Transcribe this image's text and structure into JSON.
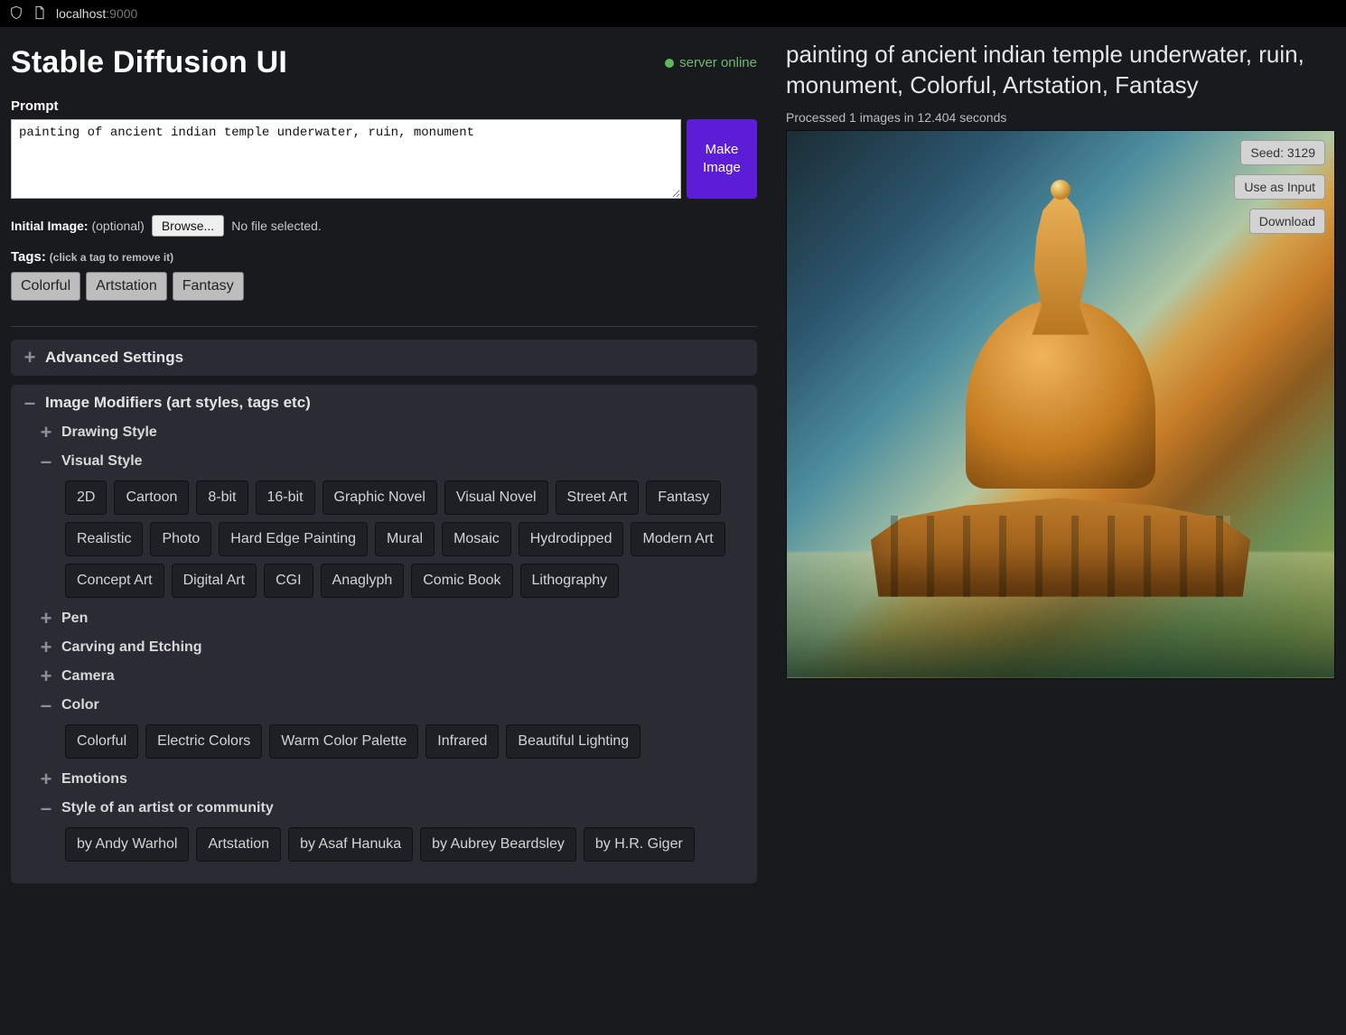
{
  "browser": {
    "url_host": "localhost",
    "url_port": ":9000"
  },
  "header": {
    "title": "Stable Diffusion UI",
    "status": "server online"
  },
  "prompt_section": {
    "label": "Prompt",
    "value": "painting of ancient indian temple underwater, ruin, monument",
    "make_button": "Make Image"
  },
  "initial_image": {
    "label": "Initial Image:",
    "optional": "(optional)",
    "browse_button": "Browse...",
    "file_status": "No file selected."
  },
  "tags": {
    "label": "Tags:",
    "hint": "(click a tag to remove it)",
    "selected": [
      "Colorful",
      "Artstation",
      "Fantasy"
    ]
  },
  "advanced": {
    "title": "Advanced Settings",
    "expanded": false
  },
  "modifiers": {
    "title": "Image Modifiers (art styles, tags etc)",
    "expanded": true,
    "categories": [
      {
        "name": "Drawing Style",
        "expanded": false,
        "tags": []
      },
      {
        "name": "Visual Style",
        "expanded": true,
        "tags": [
          "2D",
          "Cartoon",
          "8-bit",
          "16-bit",
          "Graphic Novel",
          "Visual Novel",
          "Street Art",
          "Fantasy",
          "Realistic",
          "Photo",
          "Hard Edge Painting",
          "Mural",
          "Mosaic",
          "Hydrodipped",
          "Modern Art",
          "Concept Art",
          "Digital Art",
          "CGI",
          "Anaglyph",
          "Comic Book",
          "Lithography"
        ]
      },
      {
        "name": "Pen",
        "expanded": false,
        "tags": []
      },
      {
        "name": "Carving and Etching",
        "expanded": false,
        "tags": []
      },
      {
        "name": "Camera",
        "expanded": false,
        "tags": []
      },
      {
        "name": "Color",
        "expanded": true,
        "tags": [
          "Colorful",
          "Electric Colors",
          "Warm Color Palette",
          "Infrared",
          "Beautiful Lighting"
        ]
      },
      {
        "name": "Emotions",
        "expanded": false,
        "tags": []
      },
      {
        "name": "Style of an artist or community",
        "expanded": true,
        "tags": [
          "by Andy Warhol",
          "Artstation",
          "by Asaf Hanuka",
          "by Aubrey Beardsley",
          "by H.R. Giger"
        ]
      }
    ]
  },
  "result": {
    "title": "painting of ancient indian temple underwater, ruin, monument, Colorful, Artstation, Fantasy",
    "meta": "Processed 1 images in 12.404 seconds",
    "seed_label": "Seed: 3129",
    "use_as_input": "Use as Input",
    "download": "Download"
  }
}
